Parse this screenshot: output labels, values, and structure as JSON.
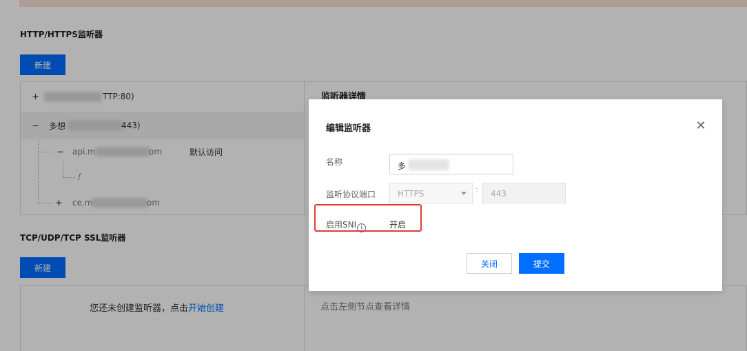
{
  "http_section": {
    "title": "HTTP/HTTPS监听器",
    "new_button": "新建",
    "tree": [
      {
        "toggle": "+",
        "text": "TTP:80)"
      },
      {
        "toggle": "−",
        "text_prefix": "多想",
        "text": "443)"
      }
    ],
    "domain_rule": {
      "toggle": "−",
      "prefix": "api.m",
      "suffix": "om",
      "tag": "默认访问"
    },
    "path_rule": "/",
    "domain_rule_2": {
      "toggle": "+",
      "prefix": "ce.m",
      "suffix": "om"
    },
    "detail_title": "监听器详情"
  },
  "tcp_section": {
    "title": "TCP/UDP/TCP SSL监听器",
    "new_button": "新建",
    "empty_text": "您还未创建监听器，点击",
    "empty_link": "开始创建",
    "detail_hint": "点击左侧节点查看详情"
  },
  "dialog": {
    "title": "编辑监听器",
    "name_label": "名称",
    "name_value": "多",
    "protocol_port_label": "监听协议端口",
    "protocol_value": "HTTPS",
    "colon": ":",
    "port_value": "443",
    "sni_label": "启用SNI",
    "sni_info_glyph": "i",
    "sni_value": "开启",
    "close_button": "关闭",
    "submit_button": "提交",
    "close_icon_glyph": "✕"
  },
  "colors": {
    "primary": "#006eff",
    "highlight": "#e53935",
    "banner": "#f6e3d4"
  }
}
